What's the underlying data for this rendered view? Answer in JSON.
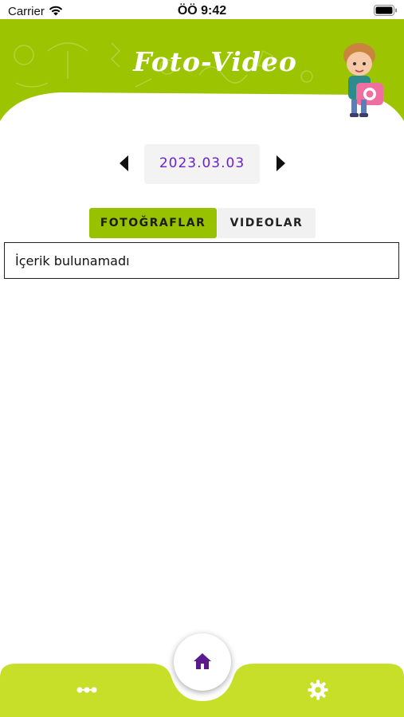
{
  "status_bar": {
    "carrier": "Carrier",
    "time": "ÖÖ 9:42"
  },
  "header": {
    "title": "Foto-Video",
    "accent_color": "#9cc400"
  },
  "date_selector": {
    "date": "2023.03.03",
    "date_color": "#6b1fd6"
  },
  "tabs": [
    {
      "label": "FOTOĞRAFLAR",
      "active": true
    },
    {
      "label": "VIDEOLAR",
      "active": false
    }
  ],
  "content": {
    "empty_message": "İçerik bulunamadı"
  },
  "bottom_nav": {
    "items": [
      {
        "icon": "dots-icon"
      },
      {
        "icon": "home-icon",
        "color": "#5a1a8c"
      },
      {
        "icon": "gear-icon"
      }
    ],
    "bar_color": "#c8df2a"
  }
}
